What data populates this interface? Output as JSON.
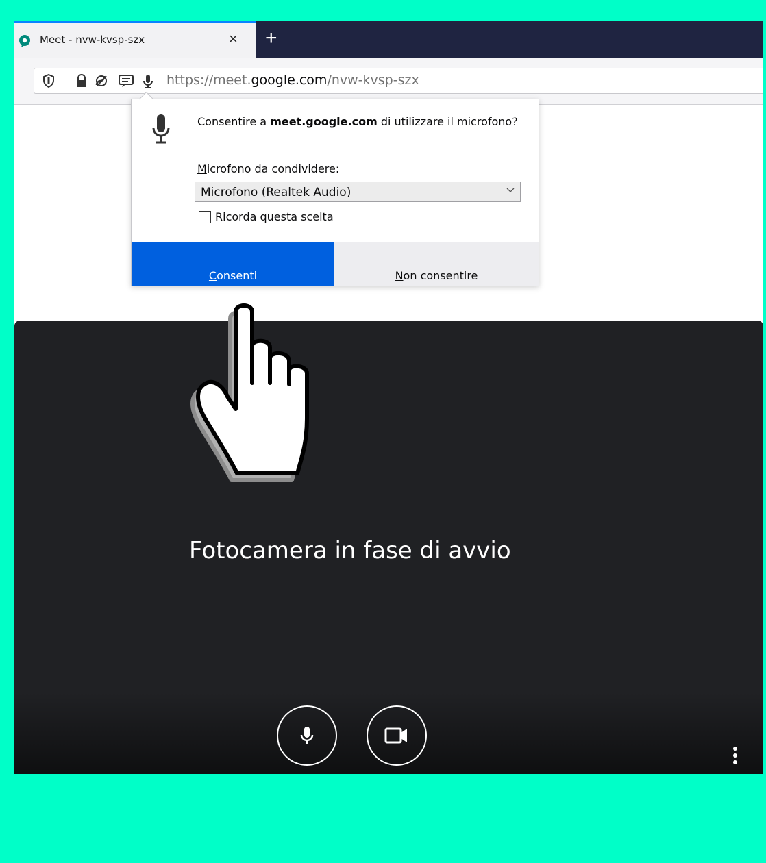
{
  "tab": {
    "title": "Meet - nvw-kvsp-szx",
    "close_glyph": "×",
    "new_tab_glyph": "+"
  },
  "navbar": {
    "url_prefix": "https://meet.",
    "url_domain": "google.com",
    "url_path": "/nvw-kvsp-szx"
  },
  "popup": {
    "message_before": "Consentire a ",
    "message_site": "meet.google.com",
    "message_after": " di utilizzare il microfono?",
    "dropdown_label_first": "M",
    "dropdown_label_rest": "icrofono da condividere:",
    "selected_device": "Microfono (Realtek Audio)",
    "remember_label": "Ricorda questa scelta",
    "remember_checked": false,
    "allow_first": "C",
    "allow_rest": "onsenti",
    "deny_first": "N",
    "deny_rest": "on consentire"
  },
  "meet": {
    "status_text": "Fotocamera in fase di avvio"
  },
  "colors": {
    "page_bg": "#00ffc8",
    "tabstrip_bg": "#1f2441",
    "allow_button": "#0060df",
    "meet_bg": "#202124"
  },
  "icons": {
    "favicon": "meet-icon",
    "shield": "shield-icon",
    "lock": "lock-icon",
    "autoplay_blocked": "autoplay-blocked-icon",
    "notifications": "notification-icon",
    "microphone": "microphone-icon",
    "camera": "camera-icon",
    "more": "more-vert-icon",
    "hand": "hand-pointer-icon"
  }
}
